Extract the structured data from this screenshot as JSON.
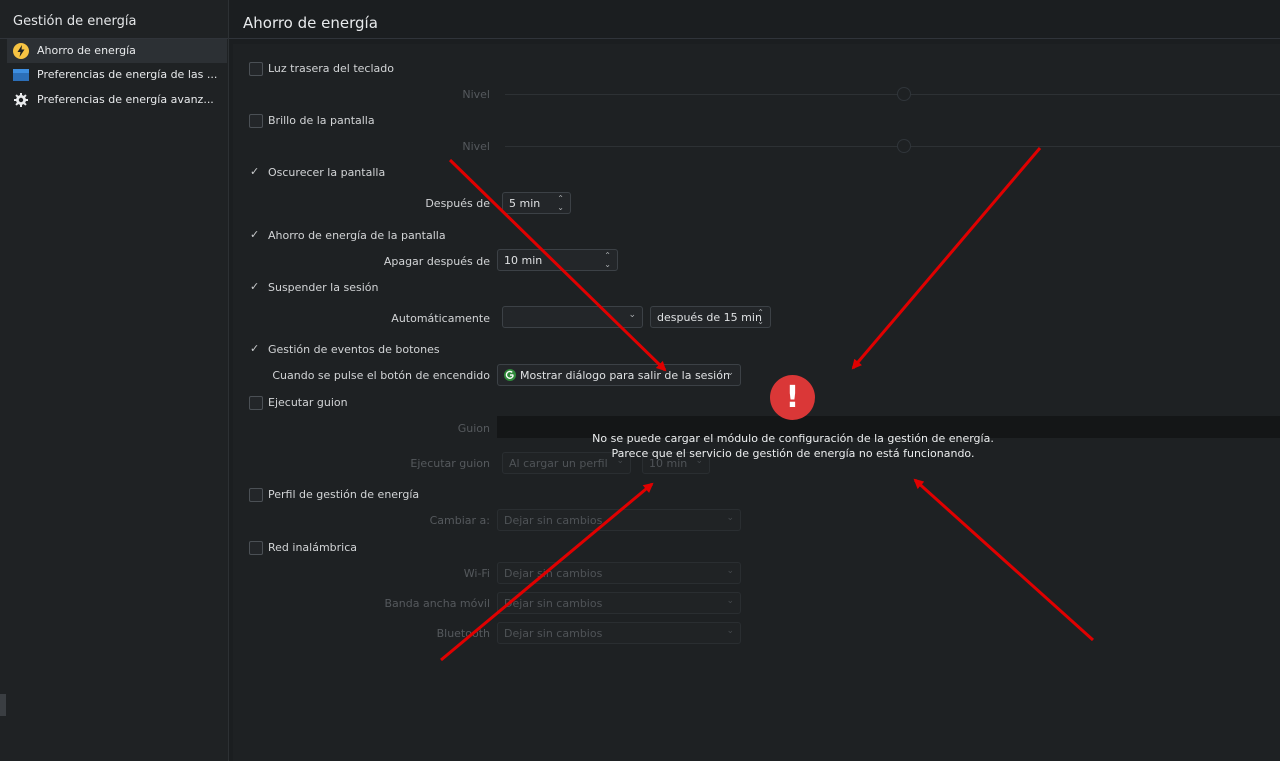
{
  "sidebar": {
    "title": "Gestión de energía",
    "items": [
      {
        "label": "Ahorro de energía",
        "icon": "lightning-icon",
        "selected": true
      },
      {
        "label": "Preferencias de energía de las ...",
        "icon": "window-icon",
        "selected": false
      },
      {
        "label": "Preferencias de energía avanz...",
        "icon": "gear-icon",
        "selected": false
      }
    ]
  },
  "header": {
    "title": "Ahorro de energía"
  },
  "form": {
    "keyboard_backlight": {
      "label": "Luz trasera del teclado",
      "checked": false,
      "level_label": "Nivel"
    },
    "screen_brightness": {
      "label": "Brillo de la pantalla",
      "checked": false,
      "level_label": "Nivel"
    },
    "dim_screen": {
      "label": "Oscurecer la pantalla",
      "checked": true,
      "after_label": "Después de",
      "after_value": "5 min"
    },
    "screen_energy_saving": {
      "label": "Ahorro de energía de la pantalla",
      "checked": true,
      "off_after_label": "Apagar después de",
      "off_after_value": "10 min"
    },
    "suspend_session": {
      "label": "Suspender la sesión",
      "checked": true,
      "auto_label": "Automáticamente",
      "action_value": "",
      "after_value": "después de 15 min"
    },
    "button_events": {
      "label": "Gestión de eventos de botones",
      "checked": true,
      "power_button_label": "Cuando se pulse el botón de encendido",
      "power_button_value": "Mostrar diálogo para salir de la sesión"
    },
    "run_script": {
      "label": "Ejecutar guion",
      "checked": false,
      "script_label": "Guion",
      "run_label": "Ejecutar guion",
      "run_value": "Al cargar un perfil",
      "run_time": "10 min"
    },
    "power_profile": {
      "label": "Perfil de gestión de energía",
      "checked": false,
      "change_label": "Cambiar a:",
      "change_value": "Dejar sin cambios"
    },
    "wireless": {
      "label": "Red inalámbrica",
      "checked": false,
      "wifi_label": "Wi-Fi",
      "wifi_value": "Dejar sin cambios",
      "mobile_label": "Banda ancha móvil",
      "mobile_value": "Dejar sin cambios",
      "bluetooth_label": "Bluetooth",
      "bluetooth_value": "Dejar sin cambios"
    }
  },
  "error": {
    "icon": "exclamation-icon",
    "line1": "No se puede cargar el módulo de configuración de la gestión de energía.",
    "line2": "Parece que el servicio de gestión de energía no está funcionando."
  },
  "colors": {
    "error_red": "#da3737",
    "arrow_red": "#e00000",
    "accent_yellow": "#f6c343",
    "accent_blue": "#3d8ee0"
  }
}
